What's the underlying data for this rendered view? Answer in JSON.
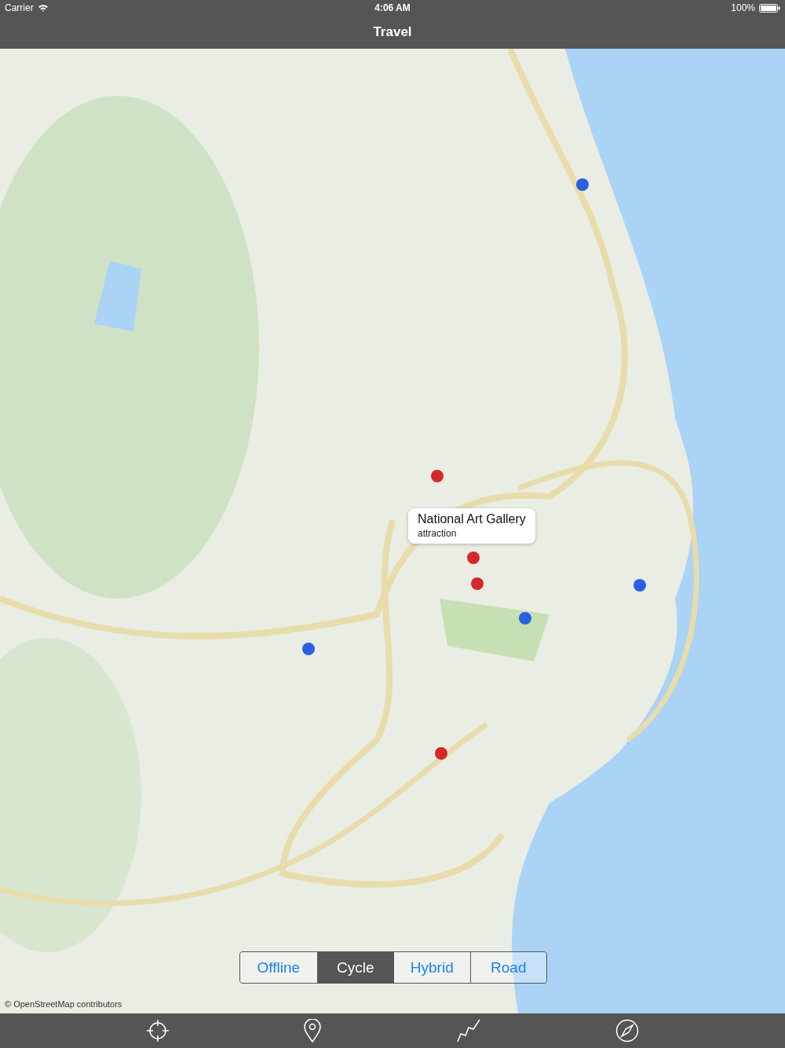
{
  "status_bar": {
    "carrier": "Carrier",
    "time": "4:06 AM",
    "battery": "100%"
  },
  "nav_bar": {
    "title": "Travel"
  },
  "map": {
    "callout": {
      "title": "National Art Gallery",
      "subtitle": "attraction"
    },
    "attribution": "© OpenStreetMap contributors",
    "map_types": [
      {
        "label": "Offline",
        "selected": false
      },
      {
        "label": "Cycle",
        "selected": true
      },
      {
        "label": "Hybrid",
        "selected": false
      },
      {
        "label": "Road",
        "selected": false
      }
    ]
  },
  "toolbar": {
    "items": [
      {
        "kind": "locate"
      },
      {
        "kind": "pin"
      },
      {
        "kind": "route"
      },
      {
        "kind": "compass"
      }
    ]
  }
}
